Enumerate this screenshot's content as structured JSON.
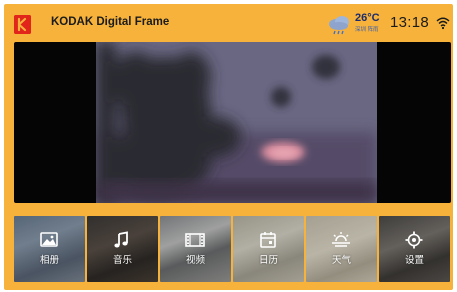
{
  "header": {
    "app_title": "KODAK Digital Frame",
    "logo_icon": "kodak-logo-icon",
    "weather_icon": "cloud-rain-icon",
    "temperature": "26°C",
    "weather_desc": "深圳 阵雨",
    "time": "13:18",
    "wifi_icon": "wifi-icon"
  },
  "colors": {
    "frame_bg": "#f6b23a",
    "logo_red": "#e1251b",
    "photo_bg": "#050505",
    "temperature_text": "#1a2b6e"
  },
  "tiles": [
    {
      "label": "相册",
      "icon": "photo-icon"
    },
    {
      "label": "音乐",
      "icon": "music-note-icon"
    },
    {
      "label": "视频",
      "icon": "film-icon"
    },
    {
      "label": "日历",
      "icon": "calendar-icon"
    },
    {
      "label": "天气",
      "icon": "weather-sun-cloud-icon"
    },
    {
      "label": "设置",
      "icon": "gear-icon"
    }
  ]
}
